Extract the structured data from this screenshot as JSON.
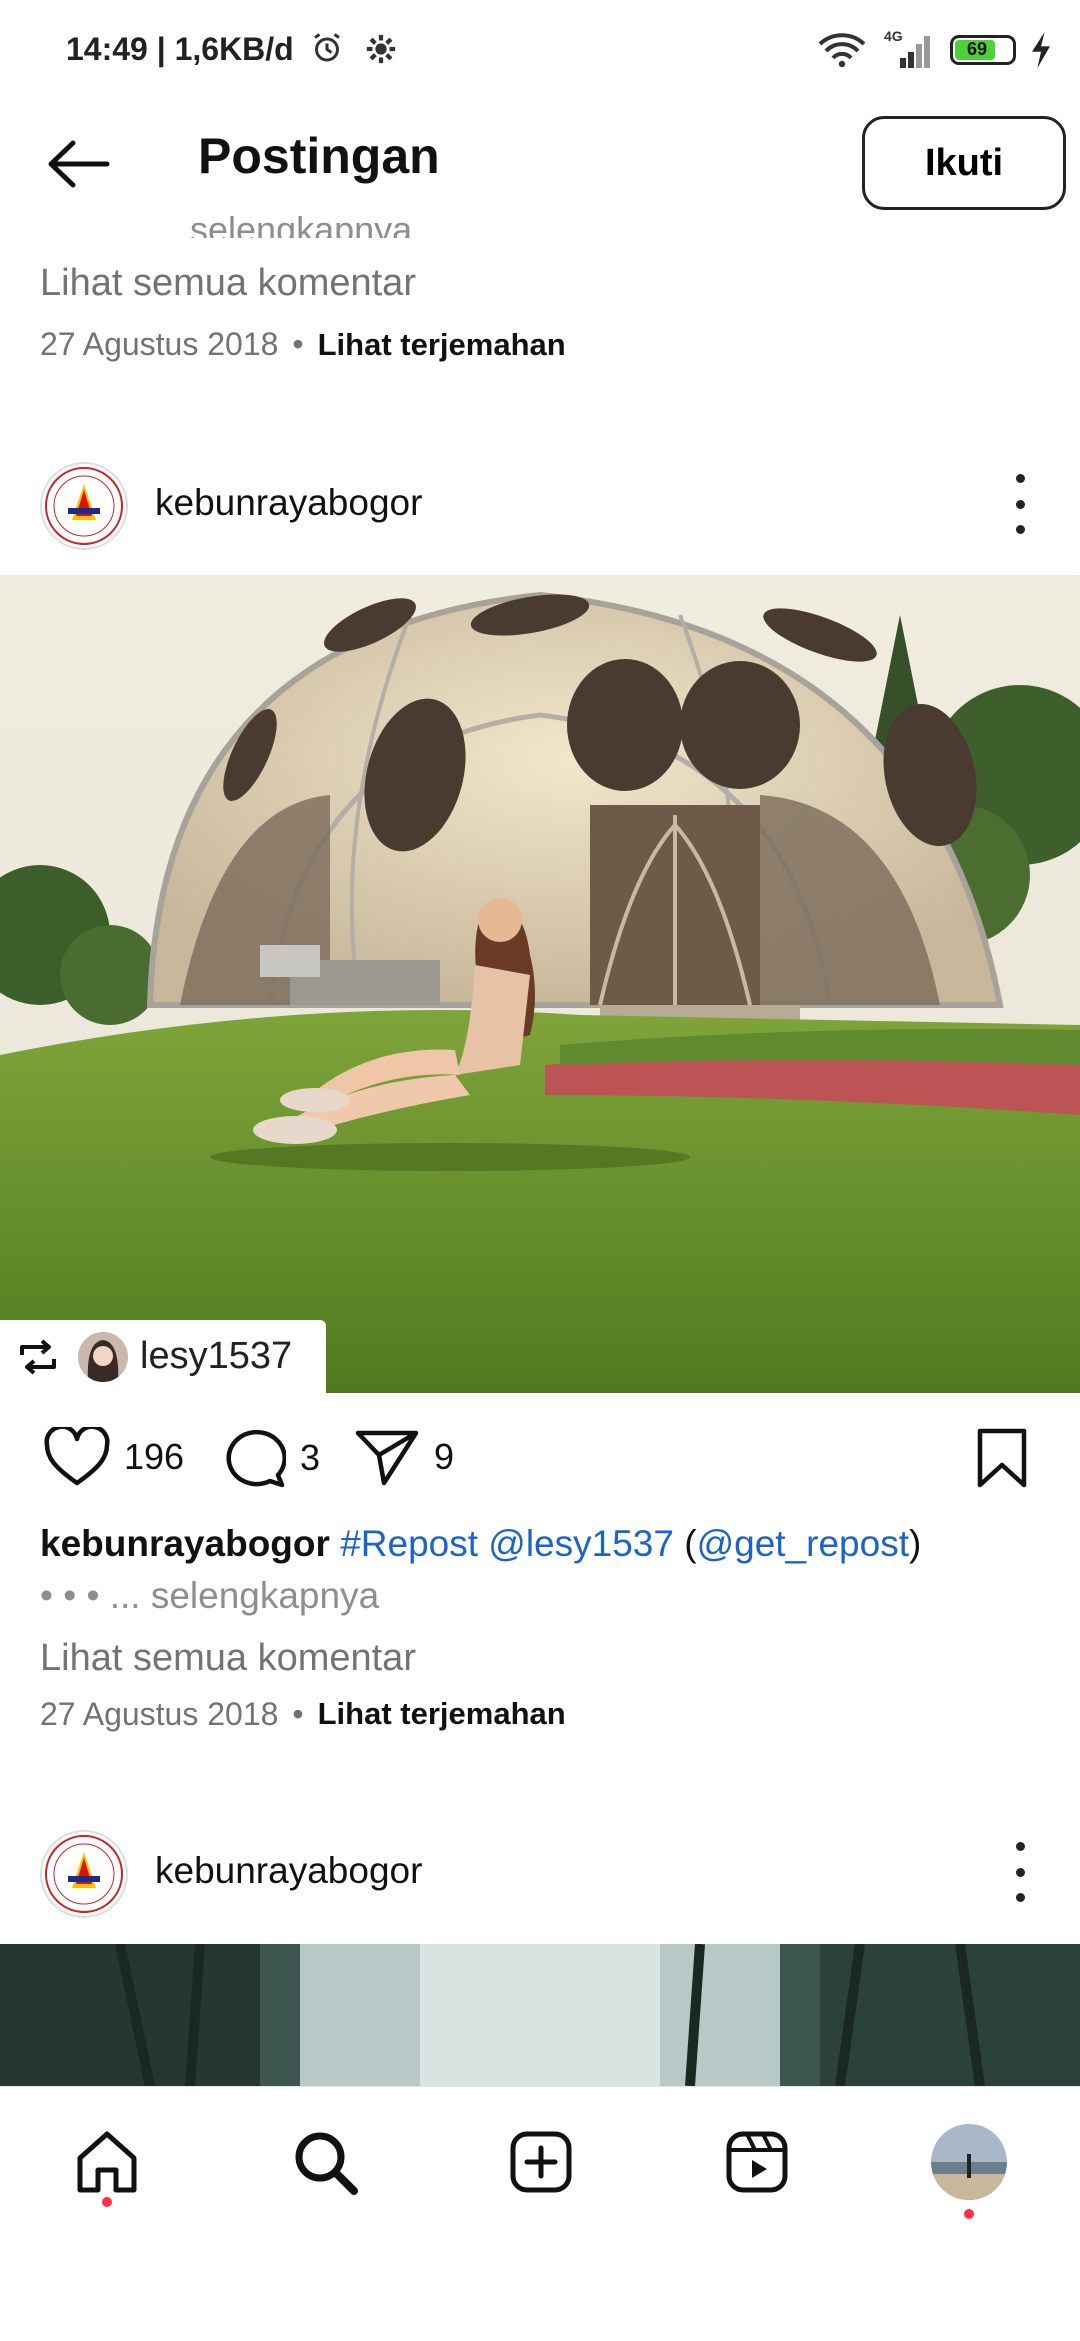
{
  "status_bar": {
    "time": "14:49",
    "net_speed": "1,6KB/d",
    "network": "4G",
    "battery": "69"
  },
  "header": {
    "title": "Postingan",
    "follow_label": "Ikuti"
  },
  "prev_post": {
    "more_text": "... selengkapnya",
    "view_comments": "Lihat semua komentar",
    "date": "27 Agustus 2018",
    "translate": "Lihat terjemahan"
  },
  "post": {
    "username": "kebunrayabogor",
    "repost_from": "lesy1537",
    "likes": "196",
    "comments": "3",
    "shares": "9",
    "caption_user": "kebunrayabogor",
    "caption_tag1": "#Repost",
    "caption_tag2": "@lesy1537",
    "caption_paren_open": "(",
    "caption_tag3": "@get_repost",
    "caption_paren_close": ")",
    "caption_more": "• • • ... selengkapnya",
    "view_comments": "Lihat semua komentar",
    "date": "27 Agustus 2018",
    "translate": "Lihat terjemahan"
  },
  "next_post": {
    "username": "kebunrayabogor"
  },
  "icons": {
    "back": "arrow-left-icon",
    "like": "heart-icon",
    "comment": "comment-icon",
    "share": "send-icon",
    "save": "bookmark-icon",
    "home": "home-icon",
    "search": "search-icon",
    "create": "plus-square-icon",
    "reels": "reels-icon"
  },
  "colors": {
    "link": "#1d63c9",
    "badge": "#ff3040",
    "muted": "#737373"
  }
}
